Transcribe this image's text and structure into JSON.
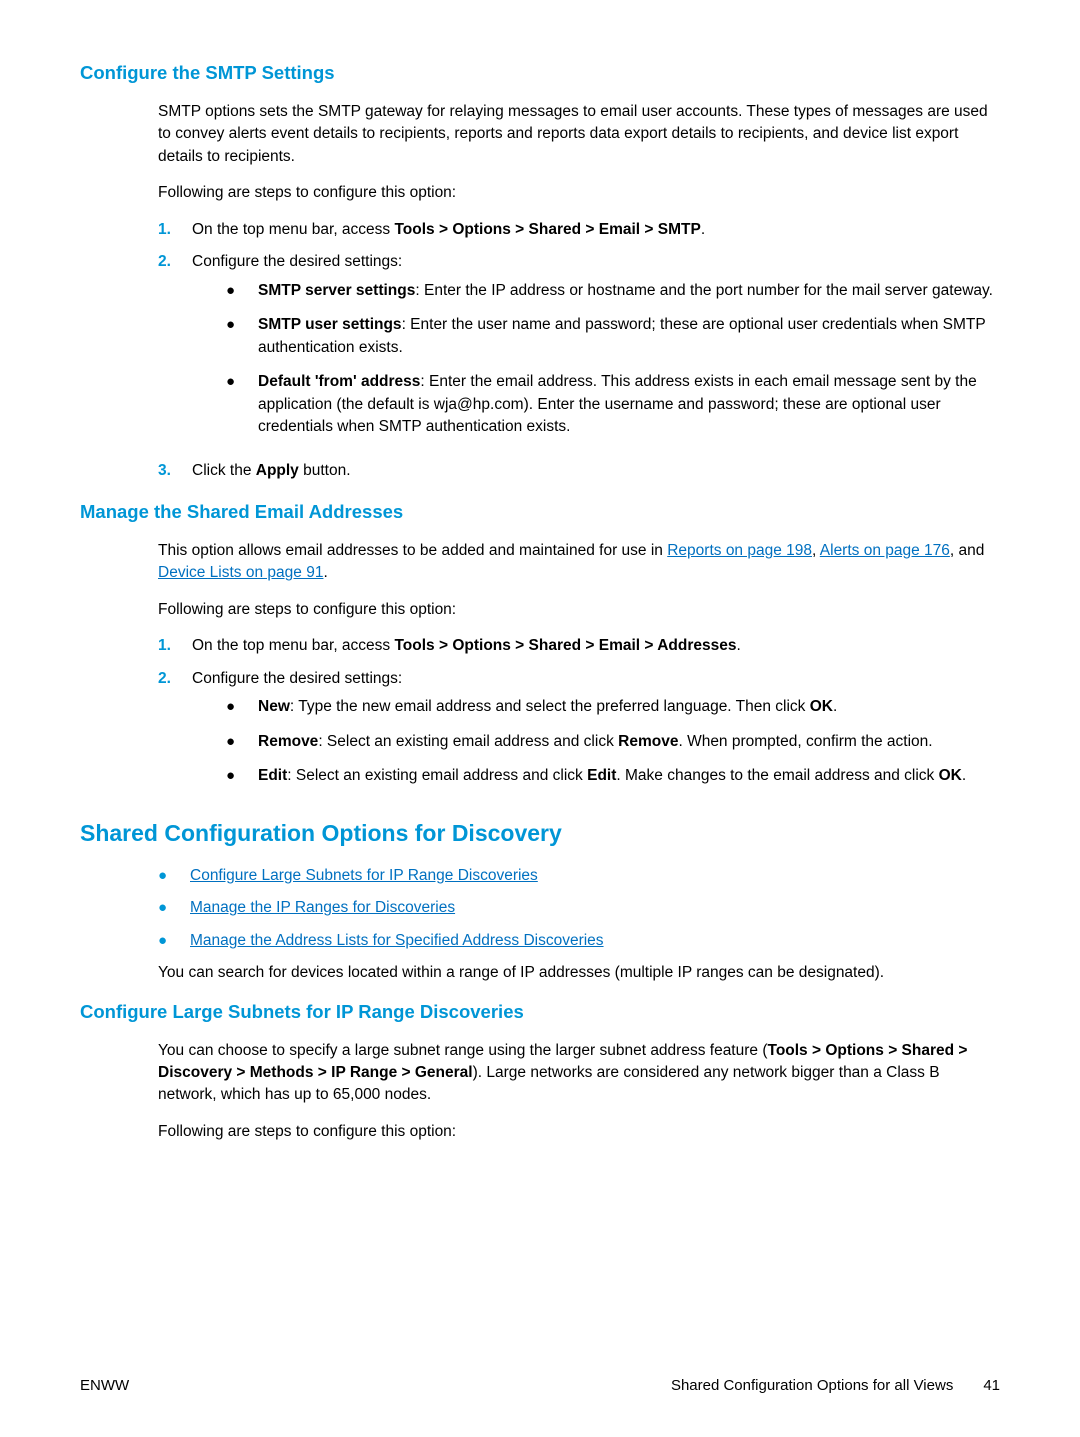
{
  "s1": {
    "title": "Configure the SMTP Settings",
    "p1": "SMTP options sets the SMTP gateway for relaying messages to email user accounts. These types of messages are used to convey alerts event details to recipients, reports and reports data export details to recipients, and device list export details to recipients.",
    "p2": "Following are steps to configure this option:",
    "step1_pre": "On the top menu bar, access ",
    "step1_bold": "Tools > Options > Shared > Email > SMTP",
    "step1_post": ".",
    "step2": "Configure the desired settings:",
    "b1_label": "SMTP server settings",
    "b1_text": ": Enter the IP address or hostname and the port number for the mail server gateway.",
    "b2_label": "SMTP user settings",
    "b2_text": ": Enter the user name and password; these are optional user credentials when SMTP authentication exists.",
    "b3_label": "Default 'from' address",
    "b3_text": ": Enter the email address. This address exists in each email message sent by the application (the default is wja@hp.com). Enter the username and password; these are optional user credentials when SMTP authentication exists.",
    "step3_pre": "Click the ",
    "step3_bold": "Apply",
    "step3_post": " button."
  },
  "s2": {
    "title": "Manage the Shared Email Addresses",
    "p1_pre": "This option allows email addresses to be added and maintained for use in ",
    "p1_link1": "Reports on page 198",
    "p1_mid1": ", ",
    "p1_link2": "Alerts on page 176",
    "p1_mid2": ", and ",
    "p1_link3": "Device Lists on page 91",
    "p1_post": ".",
    "p2": "Following are steps to configure this option:",
    "step1_pre": "On the top menu bar, access ",
    "step1_bold": "Tools > Options > Shared > Email > Addresses",
    "step1_post": ".",
    "step2": "Configure the desired settings:",
    "b1_label": "New",
    "b1_text1": ": Type the new email address and select the preferred language. Then click ",
    "b1_bold": "OK",
    "b1_text2": ".",
    "b2_label": "Remove",
    "b2_text1": ": Select an existing email address and click ",
    "b2_bold": "Remove",
    "b2_text2": ". When prompted, confirm the action.",
    "b3_label": "Edit",
    "b3_text1": ": Select an existing email address and click ",
    "b3_bold1": "Edit",
    "b3_text2": ". Make changes to the email address and click ",
    "b3_bold2": "OK",
    "b3_text3": "."
  },
  "s3": {
    "title": "Shared Configuration Options for Discovery",
    "link1": "Configure Large Subnets for IP Range Discoveries",
    "link2": "Manage the IP Ranges for Discoveries",
    "link3": "Manage the Address Lists for Specified Address Discoveries",
    "p1": "You can search for devices located within a range of IP addresses (multiple IP ranges can be designated)."
  },
  "s4": {
    "title": "Configure Large Subnets for IP Range Discoveries",
    "p1_pre": "You can choose to specify a large subnet range using the larger subnet address feature (",
    "p1_bold": "Tools > Options > Shared > Discovery > Methods > IP Range > General",
    "p1_post": "). Large networks are considered any network bigger than a Class B network, which has up to 65,000 nodes.",
    "p2": "Following are steps to configure this option:"
  },
  "footer": {
    "left": "ENWW",
    "right": "Shared Configuration Options for all Views  41"
  }
}
